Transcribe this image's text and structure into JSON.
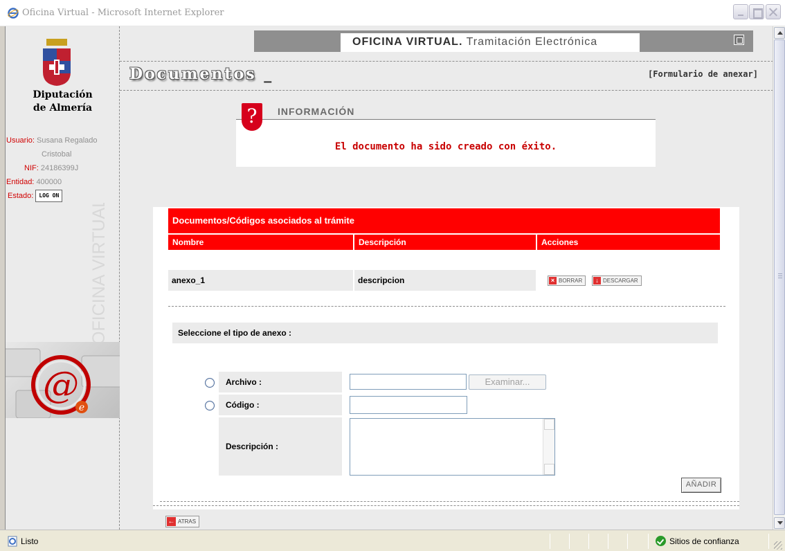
{
  "window": {
    "title": "Oficina Virtual - Microsoft Internet Explorer"
  },
  "sidebar": {
    "org_name_line1": "Diputación",
    "org_name_line2": "de Almería",
    "user_label": "Usuario:",
    "user_value_line1": "Susana Regalado",
    "user_value_line2": "Cristobal",
    "nif_label": "NIF:",
    "nif_value": "24186399J",
    "entity_label": "Entidad:",
    "entity_value": "400000",
    "status_label": "Estado:",
    "logon_label": "LOG ON",
    "vertical_brand": "OFICINA VIRTUAL"
  },
  "header": {
    "brand_bold": "OFICINA VIRTUAL.",
    "brand_rest": " Tramitación Electrónica"
  },
  "page": {
    "title": "Documentos",
    "title_cursor": " _",
    "breadcrumb": "[Formulario de anexar]"
  },
  "info": {
    "title": "INFORMACIÓN",
    "icon": "?",
    "message": "El documento ha sido creado con éxito."
  },
  "documents": {
    "section_title": "Documentos/Códigos asociados al trámite",
    "columns": [
      "Nombre",
      "Descripción",
      "Acciones"
    ],
    "rows": [
      {
        "name": "anexo_1",
        "description": "descripcion"
      }
    ],
    "delete_label": "BORRAR",
    "download_label": "DESCARGAR"
  },
  "form": {
    "select_label": "Seleccione el tipo de anexo :",
    "file_label": "Archivo :",
    "file_value": "",
    "browse_label": "Examinar...",
    "code_label": "Código :",
    "code_value": "",
    "description_label": "Descripción :",
    "description_value": "",
    "add_label": "AÑADIR",
    "back_label": "ATRAS"
  },
  "statusbar": {
    "status": "Listo",
    "zone": "Sitios de confianza"
  },
  "colors": {
    "accent_red": "#ff0000",
    "message_red": "#c80000",
    "header_gray": "#8f8f8f",
    "panel_gray": "#ebebeb",
    "zone_green": "#2a9a2a"
  },
  "icons": {
    "browser": "ie-icon",
    "minimize": "minimize-icon",
    "maximize": "maximize-icon",
    "close": "close-icon",
    "help": "question-mark-icon",
    "delete": "delete-icon",
    "download": "download-icon",
    "back": "back-arrow-icon",
    "trusted_zone": "check-circle-icon"
  }
}
